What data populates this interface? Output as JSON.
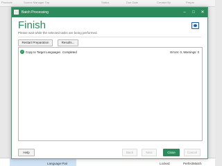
{
  "background": {
    "header_cols": [
      "Products",
      "Source Manager Top",
      "Status",
      "Due Date",
      "Created By",
      "Prepar"
    ],
    "row": {
      "name": "Language Pair",
      "status": "Locked",
      "match": "PerfectMatch"
    }
  },
  "dialog": {
    "title": "Batch Processing",
    "heading": "Finish",
    "subheading": "Please wait while the selected tasks are being performed.",
    "buttons": {
      "restart": "Restart Preparation",
      "results": "Results...",
      "help": "Help",
      "back": "Back",
      "next": "Next",
      "close": "Close",
      "cancel": "Cancel"
    },
    "tasks": [
      {
        "name": "Copy to Target Languages",
        "status": "Completed",
        "result": "Errors: 0, Warnings: 0"
      }
    ]
  },
  "colors": {
    "accent": "#2d8a5b",
    "success": "#2d9a5b"
  },
  "icons": {
    "task_status": "check-circle-icon",
    "report": "report-icon"
  }
}
